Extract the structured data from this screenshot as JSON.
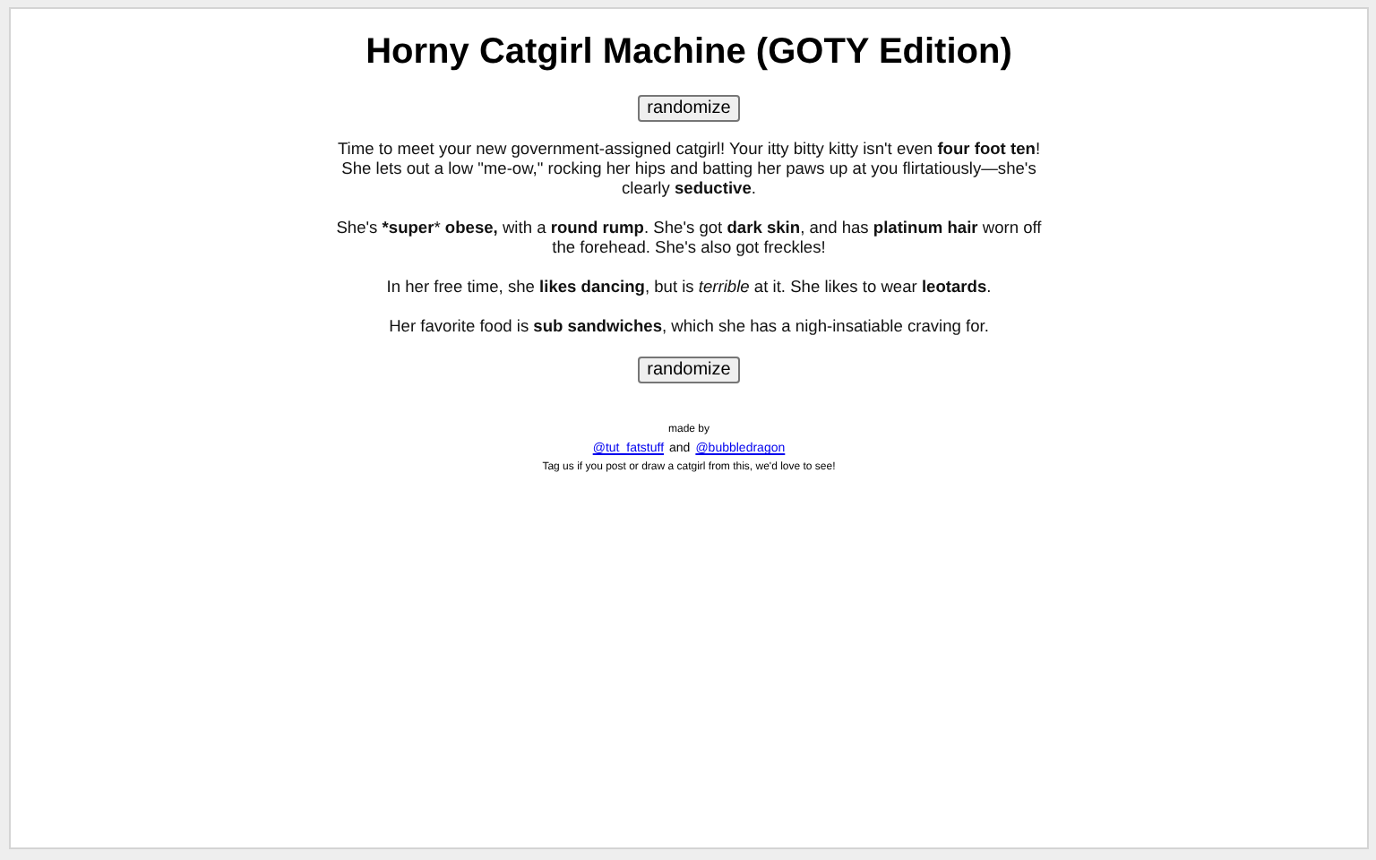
{
  "title": "Horny Catgirl Machine (GOTY Edition)",
  "buttons": [
    "randomize",
    "randomize"
  ],
  "paragraphs": [
    "Time to meet your new government-assigned catgirl! Your itty bitty kitty isn't even **four foot ten**! She lets out a low \"me-ow,\" rocking her hips and batting her paws up at you flirtatiously—she's clearly **seductive**.",
    "She's ***super*** **obese,** with a **round rump**. She's got **dark skin**, and has **platinum hair** worn off the forehead. She's also got freckles!",
    "In her free time, she **likes dancing**, but is *terrible* at it. She likes to wear **leotards**.",
    "Her favorite food is **sub sandwiches**, which she has a nigh-insatiable craving for."
  ],
  "footer": {
    "made_by": "made by",
    "links": [
      "@tut_fatstuff",
      "@bubbledragon"
    ],
    "joiner": "and",
    "note": "Tag us if you post or draw a catgirl from this, we'd love to see!"
  }
}
